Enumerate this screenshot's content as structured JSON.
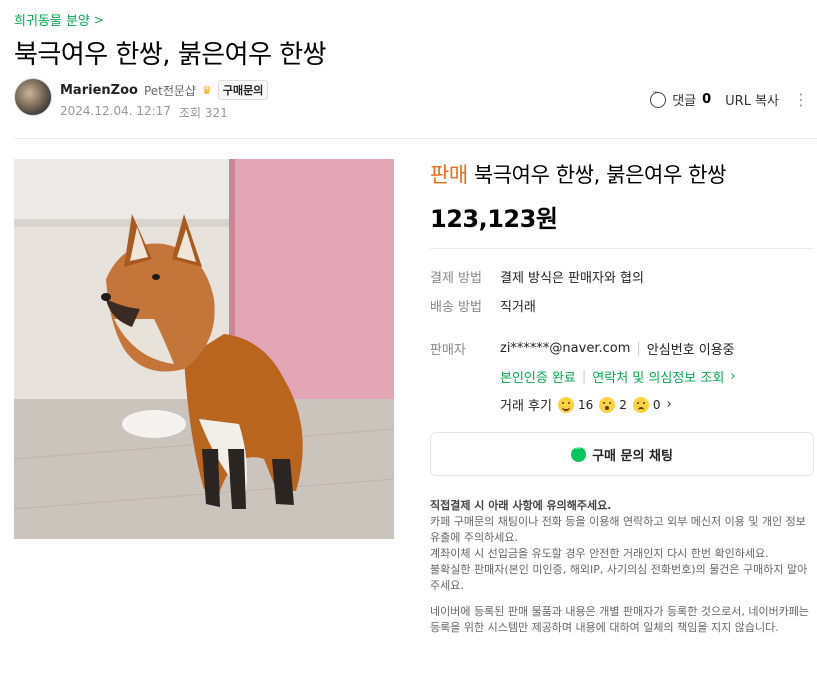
{
  "breadcrumb": {
    "label": "희귀동물 분양",
    "chevron": ">"
  },
  "post": {
    "title": "북극여우 한쌍, 붉은여우 한쌍",
    "author": "MarienZoo",
    "rank": "Pet전문샵",
    "inquiry_badge": "구매문의",
    "date": "2024.12.04. 12:17",
    "views_label": "조회",
    "views": "321"
  },
  "actions": {
    "comment_label": "댓글",
    "comment_count": "0",
    "url_copy": "URL 복사",
    "more_icon": "more-vertical-icon"
  },
  "listing": {
    "status": "판매",
    "title": "북극여우 한쌍, 붉은여우 한쌍",
    "price": "123,123원",
    "payment_label": "결제 방법",
    "payment_value": "결제 방식은 판매자와 협의",
    "delivery_label": "배송 방법",
    "delivery_value": "직거래",
    "seller_label": "판매자",
    "seller_email": "zi******@naver.com",
    "safe_number": "안심번호 이용중",
    "verified": "본인인증 완료",
    "contact_check": "연락처 및 의심정보 조회",
    "review_label": "거래 후기",
    "reviews": {
      "good": "16",
      "neutral": "2",
      "bad": "0"
    },
    "chat_button": "구매 문의 채팅"
  },
  "notice": {
    "heading": "직접결제 시 아래 사항에 유의해주세요.",
    "line1": "카페 구매문의 채팅이나 전화 등을 이용해 연락하고 외부 메신저 이용 및 개인 정보 유출에 주의하세요.",
    "line2": "계좌이체 시 선입금을 유도할 경우 안전한 거래인지 다시 한번 확인하세요.",
    "line3": "불확실한 판매자(본인 미인증, 해외IP, 사기의심 전화번호)의 물건은 구매하지 말아주세요.",
    "line4": "네이버에 등록된 판매 물품과 내용은 개별 판매자가 등록한 것으로서, 네이버카페는 등록을 위한 시스템만 제공하며 내용에 대하여 일체의 책임을 지지 않습니다."
  },
  "colors": {
    "accent_green": "#03a94d",
    "sale_orange": "#f26a1b",
    "chat_green": "#03c75a"
  }
}
